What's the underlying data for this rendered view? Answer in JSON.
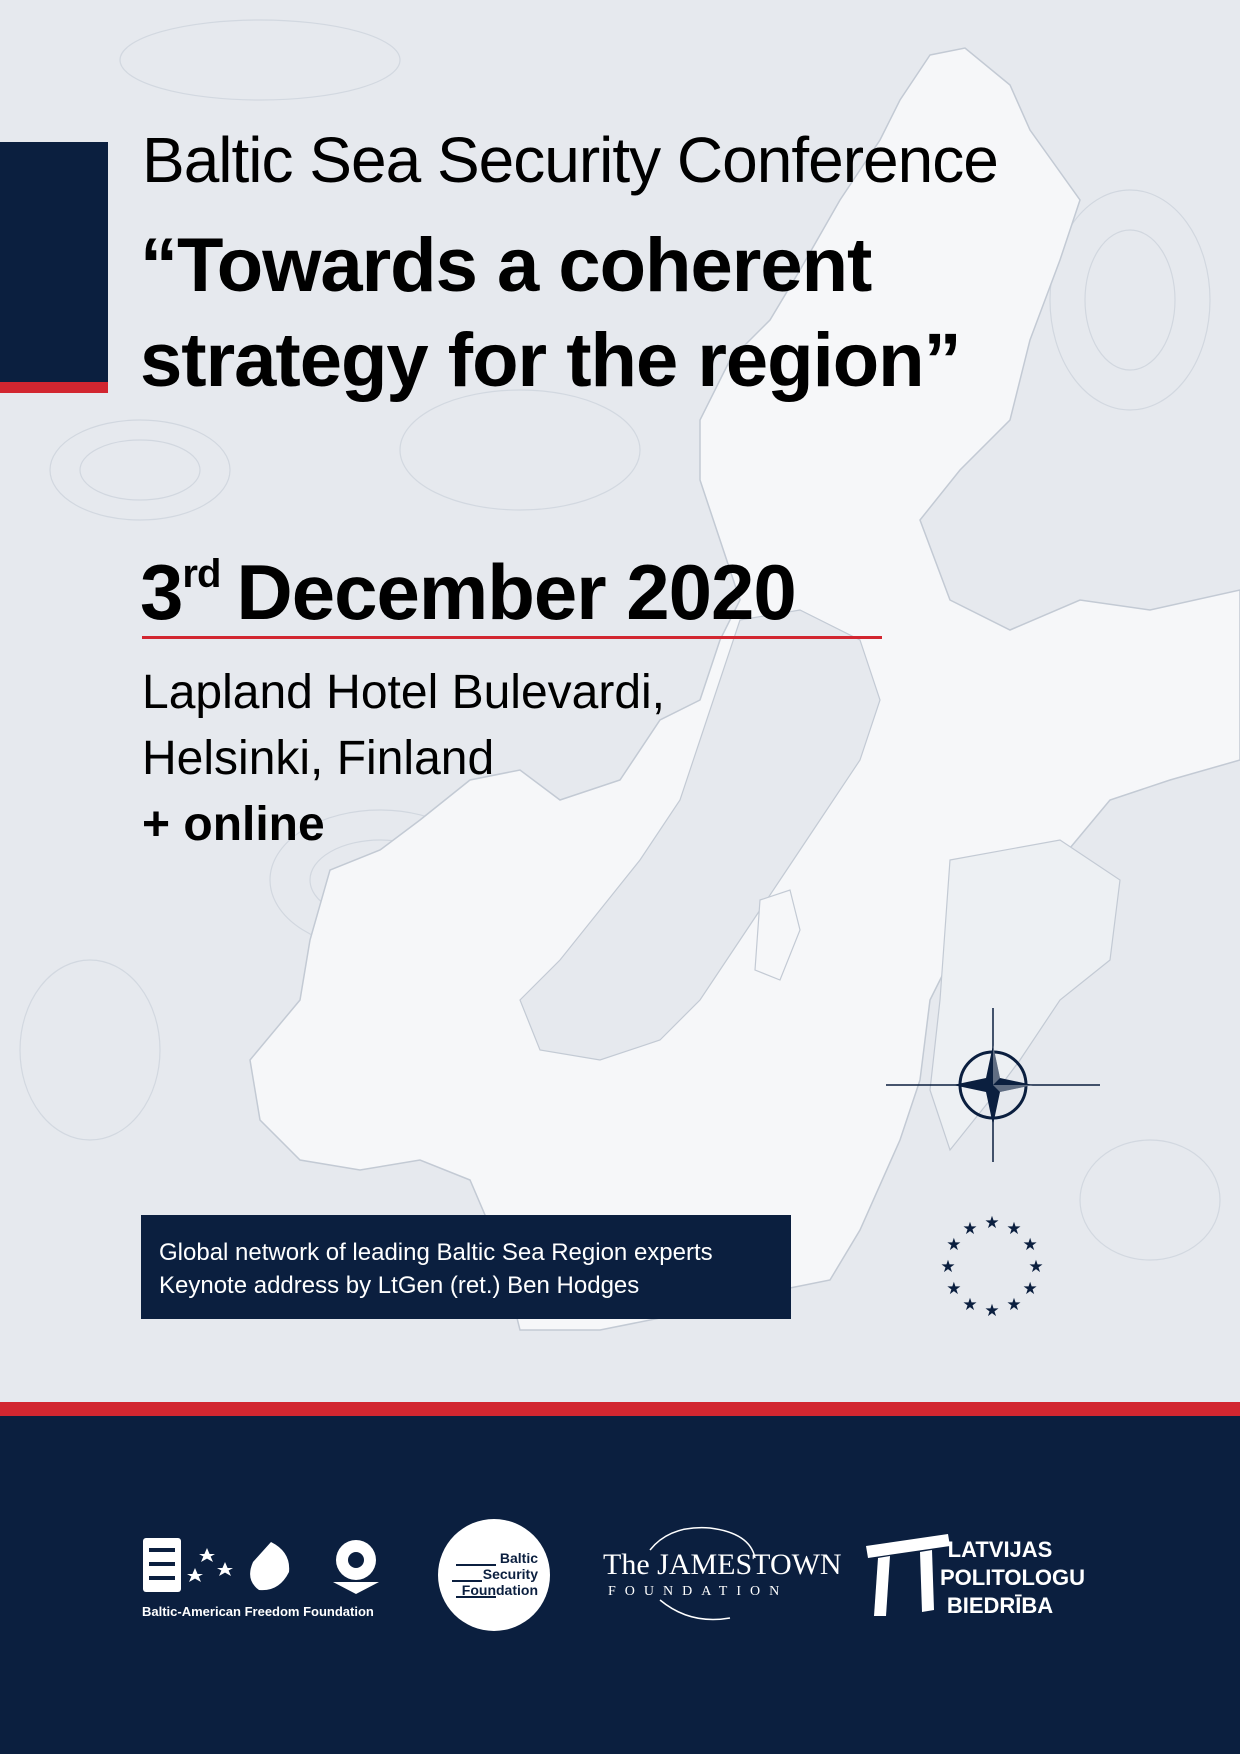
{
  "header": {
    "conference_name": "Baltic Sea Security Conference",
    "tagline_line1": "“Towards a coherent",
    "tagline_line2": "strategy for the region”"
  },
  "event": {
    "date_day": "3",
    "date_suffix": "rd",
    "date_rest": "December 2020",
    "venue_line1": "Lapland Hotel Bulevardi,",
    "venue_line2": "Helsinki, Finland",
    "online": "+ online"
  },
  "highlights": [
    "Global network of leading Baltic Sea Region experts",
    "Keynote address by LtGen (ret.) Ben Hodges"
  ],
  "emblems": {
    "nato": "nato-compass-icon",
    "eu": "eu-stars-icon"
  },
  "partners": {
    "bamf_caption": "Baltic-American Freedom Foundation",
    "bsf_line1": "Baltic",
    "bsf_line2": "Security",
    "bsf_line3": "Foundation",
    "jamestown_title": "The JAMESTOWN",
    "jamestown_sub": "FOUNDATION",
    "lpb_line1": "LATVIJAS",
    "lpb_line2": "POLITOLOGU",
    "lpb_line3": "BIEDRĪBA"
  },
  "colors": {
    "navy": "#0b1f3f",
    "red": "#d22630",
    "background": "#e6e9ee",
    "land": "#f6f7f9"
  }
}
